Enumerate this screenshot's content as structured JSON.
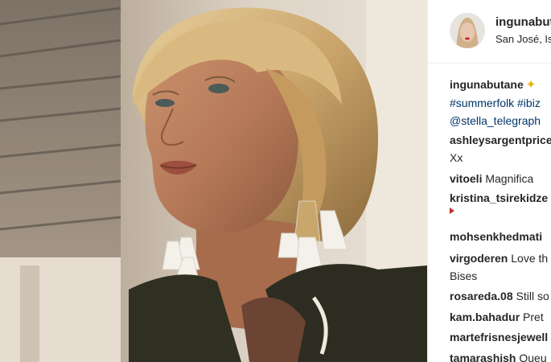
{
  "post": {
    "username": "ingunabut",
    "location": "San José, Isl"
  },
  "caption": {
    "author": "ingunabutane",
    "line2": "#summerfolk #ibiz",
    "line3": "@stella_telegraph"
  },
  "comments": [
    {
      "user": "ashleysargentprice",
      "text": "",
      "cont": "Xx"
    },
    {
      "user": "vitoeli",
      "text": "Magnifica",
      "cont": ""
    },
    {
      "user": "kristina_tsirekidze",
      "text": "",
      "cont": ""
    },
    {
      "user": "mohsenkhedmati",
      "text": "",
      "cont": ""
    },
    {
      "user": "virgoderen",
      "text": "Love th",
      "cont": "Bises"
    },
    {
      "user": "rosareda.08",
      "text": "Still so",
      "cont": ""
    },
    {
      "user": "kam.bahadur",
      "text": "Pret",
      "cont": ""
    },
    {
      "user": "martefrisnesjewell",
      "text": "",
      "cont": ""
    },
    {
      "user": "tamarashish",
      "text": "Queu",
      "cont": ""
    }
  ],
  "colors": {
    "link": "#003569",
    "text": "#262626"
  },
  "icons": [
    "sparkle-icon",
    "heart-icon"
  ]
}
